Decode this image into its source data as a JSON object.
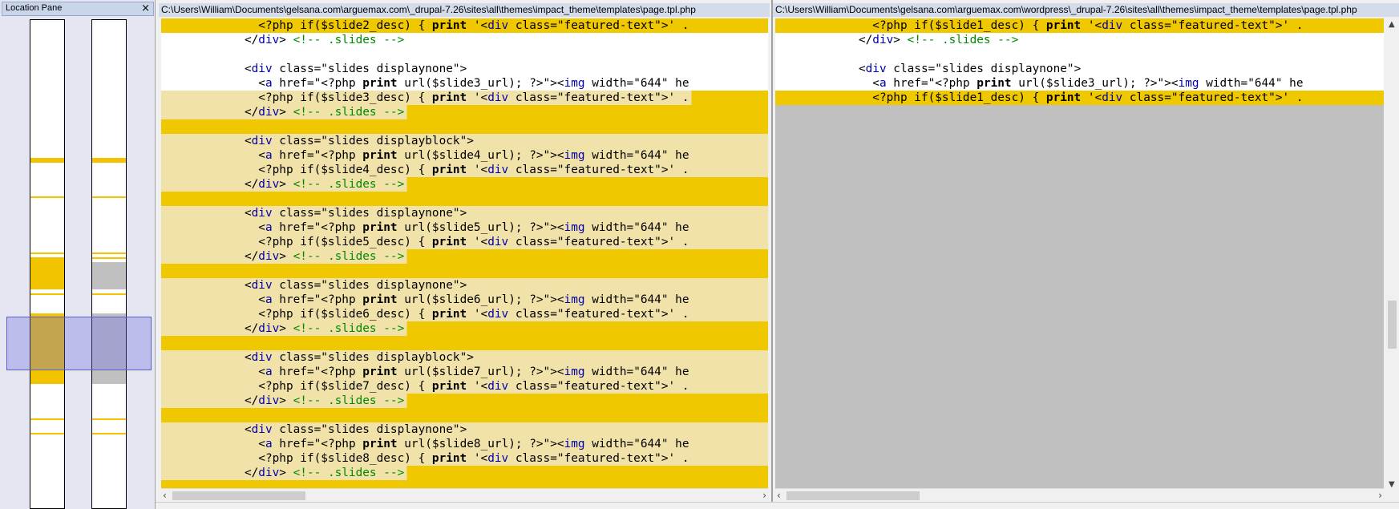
{
  "location_pane": {
    "title": "Location Pane",
    "close_icon": "close-icon",
    "viewport_indicator": true
  },
  "left_pane": {
    "path": "C:\\Users\\William\\Documents\\gelsana.com\\arguemax.com\\_drupal-7.26\\sites\\all\\themes\\impact_theme\\templates\\page.tpl.php",
    "lines": [
      "              <?php if($slide2_desc) { print '<div class=\"featured-text\">' .",
      "            </div> <!-- .slides -->",
      "",
      "            <div class=\"slides displaynone\">",
      "              <a href=\"<?php print url($slide3_url); ?>\"><img width=\"644\" he",
      "              <?php if($slide3_desc) { print '<div class=\"featured-text\">' .",
      "            </div> <!-- .slides -->",
      "",
      "            <div class=\"slides displayblock\">",
      "              <a href=\"<?php print url($slide4_url); ?>\"><img width=\"644\" he",
      "              <?php if($slide4_desc) { print '<div class=\"featured-text\">' .",
      "            </div> <!-- .slides -->",
      "",
      "            <div class=\"slides displaynone\">",
      "              <a href=\"<?php print url($slide5_url); ?>\"><img width=\"644\" he",
      "              <?php if($slide5_desc) { print '<div class=\"featured-text\">' .",
      "            </div> <!-- .slides -->",
      "",
      "            <div class=\"slides displaynone\">",
      "              <a href=\"<?php print url($slide6_url); ?>\"><img width=\"644\" he",
      "              <?php if($slide6_desc) { print '<div class=\"featured-text\">' .",
      "            </div> <!-- .slides -->",
      "",
      "            <div class=\"slides displayblock\">",
      "              <a href=\"<?php print url($slide7_url); ?>\"><img width=\"644\" he",
      "              <?php if($slide7_desc) { print '<div class=\"featured-text\">' .",
      "            </div> <!-- .slides -->",
      "",
      "            <div class=\"slides displaynone\">",
      "              <a href=\"<?php print url($slide8_url); ?>\"><img width=\"644\" he",
      "              <?php if($slide8_desc) { print '<div class=\"featured-text\">' .",
      "            </div> <!-- .slides -->",
      ""
    ]
  },
  "right_pane": {
    "path": "C:\\Users\\William\\Documents\\gelsana.com\\arguemax.com\\wordpress\\_drupal-7.26\\sites\\all\\themes\\impact_theme\\templates\\page.tpl.php",
    "lines": [
      "              <?php if($slide1_desc) { print '<div class=\"featured-text\">' .",
      "            </div> <!-- .slides -->",
      "",
      "            <div class=\"slides displaynone\">",
      "              <a href=\"<?php print url($slide3_url); ?>\"><img width=\"644\" he",
      "              <?php if($slide1_desc) { print '<div class=\"featured-text\">' ."
    ]
  },
  "colors": {
    "diff_dark": "#f0c800",
    "diff_light": "#f1e2a9",
    "missing": "#c0c0c0",
    "keyword": "#0000aa",
    "comment": "#008800"
  }
}
